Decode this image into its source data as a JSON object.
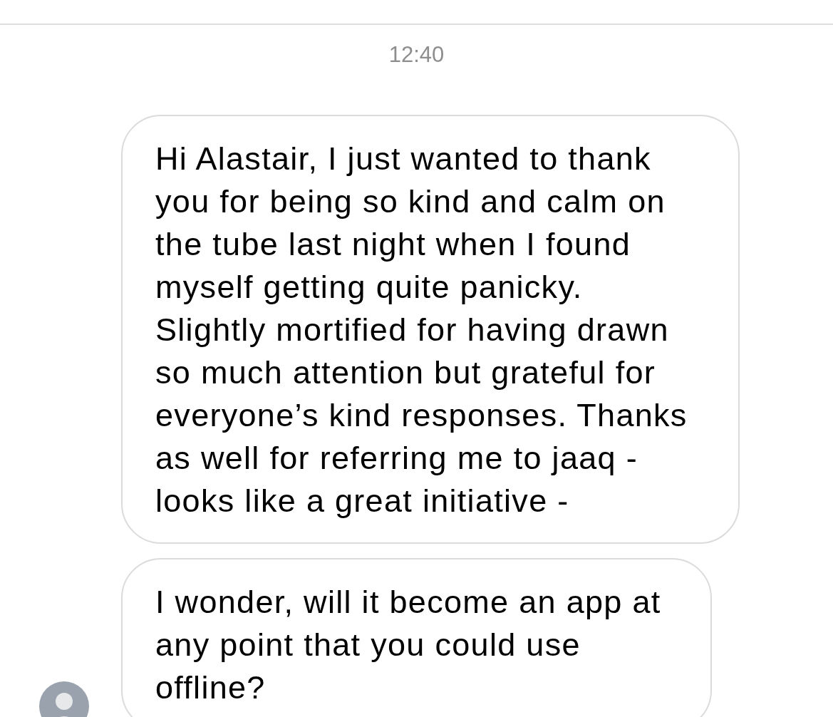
{
  "timestamp": "12:40",
  "messages": [
    {
      "text": "Hi Alastair, I just wanted to thank you for being so kind and calm on the tube last night when I found myself getting quite panicky. Slightly mortified for having drawn so much attention but grateful for everyone’s kind responses. Thanks as well for referring me to jaaq - looks like a great initiative -",
      "show_avatar": false
    },
    {
      "text": "I wonder, will it become an app at any point that you could use offline?",
      "show_avatar": true
    }
  ]
}
